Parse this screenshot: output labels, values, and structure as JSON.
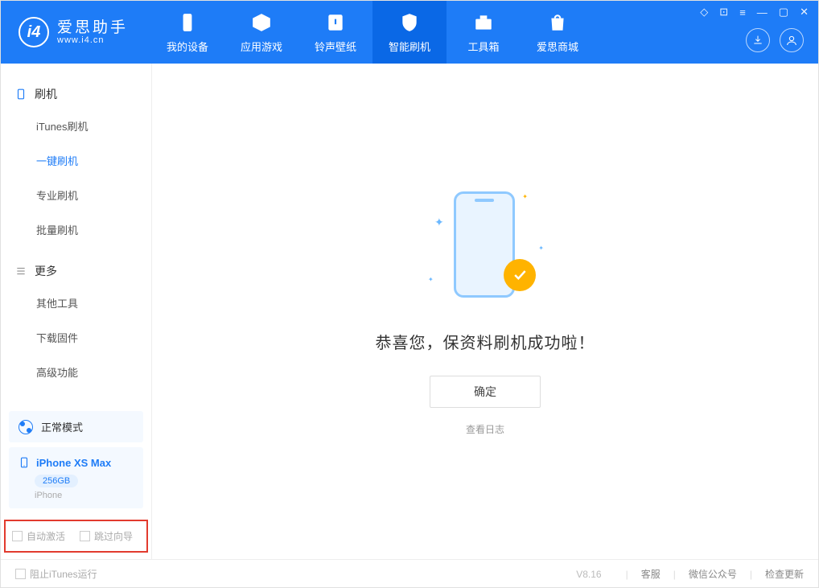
{
  "app": {
    "title": "爱思助手",
    "subtitle": "www.i4.cn"
  },
  "tabs": [
    {
      "label": "我的设备"
    },
    {
      "label": "应用游戏"
    },
    {
      "label": "铃声壁纸"
    },
    {
      "label": "智能刷机"
    },
    {
      "label": "工具箱"
    },
    {
      "label": "爱思商城"
    }
  ],
  "sidebar": {
    "section1_title": "刷机",
    "items1": [
      {
        "label": "iTunes刷机"
      },
      {
        "label": "一键刷机"
      },
      {
        "label": "专业刷机"
      },
      {
        "label": "批量刷机"
      }
    ],
    "section2_title": "更多",
    "items2": [
      {
        "label": "其他工具"
      },
      {
        "label": "下载固件"
      },
      {
        "label": "高级功能"
      }
    ]
  },
  "mode": {
    "label": "正常模式"
  },
  "device": {
    "name": "iPhone XS Max",
    "storage": "256GB",
    "type": "iPhone"
  },
  "options": {
    "auto_activate": "自动激活",
    "skip_guide": "跳过向导"
  },
  "main": {
    "success": "恭喜您，保资料刷机成功啦！",
    "ok": "确定",
    "view_log": "查看日志"
  },
  "footer": {
    "block_itunes": "阻止iTunes运行",
    "version": "V8.16",
    "support": "客服",
    "wechat": "微信公众号",
    "update": "检查更新"
  }
}
